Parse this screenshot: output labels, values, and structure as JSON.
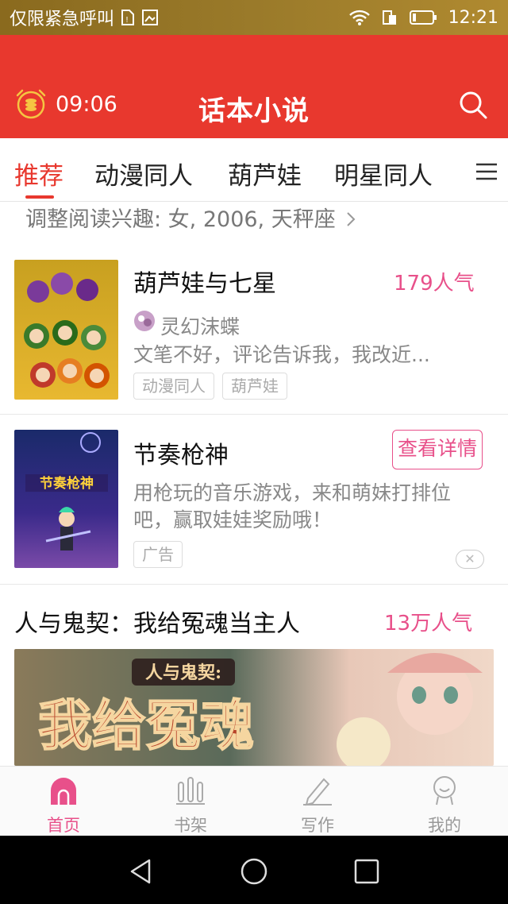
{
  "status_bar": {
    "carrier": "仅限紧急呼叫",
    "time": "12:21"
  },
  "header": {
    "timer": "09:06",
    "title": "话本小说",
    "accent_color": "#e8382e"
  },
  "tabs": [
    {
      "label": "推荐",
      "active": true
    },
    {
      "label": "动漫同人",
      "active": false
    },
    {
      "label": "葫芦娃",
      "active": false
    },
    {
      "label": "明星同人",
      "active": false
    }
  ],
  "interest": {
    "text": "调整阅读兴趣: 女, 2006, 天秤座"
  },
  "book1": {
    "title": "葫芦娃与七星",
    "popularity": "179人气",
    "author": "灵幻沫蝶",
    "description": "文笔不好，评论告诉我，我改近...",
    "tags": [
      "动漫同人",
      "葫芦娃"
    ]
  },
  "ad": {
    "title": "节奏枪神",
    "button": "查看详情",
    "description": "用枪玩的音乐游戏，来和萌妹打排位吧，赢取娃娃奖励哦！",
    "tag": "广告",
    "cover_text": "节奏枪神"
  },
  "book2": {
    "title": "人与鬼契：我给冤魂当主人",
    "popularity": "13万人气",
    "banner_subtitle": "人与鬼契:",
    "banner_title": "我给冤魂"
  },
  "bottom_nav": [
    {
      "label": "首页",
      "active": true
    },
    {
      "label": "书架",
      "active": false
    },
    {
      "label": "写作",
      "active": false
    },
    {
      "label": "我的",
      "active": false
    }
  ]
}
